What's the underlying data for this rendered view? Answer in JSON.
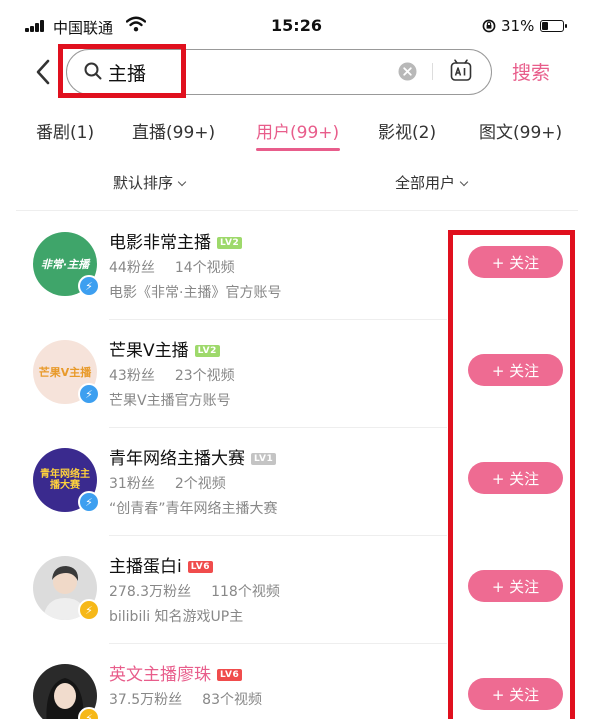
{
  "status_bar": {
    "carrier": "中国联通",
    "time": "15:26",
    "battery": "31%",
    "battery_level": 0.31
  },
  "search": {
    "query": "主播",
    "button": "搜索"
  },
  "tabs": [
    {
      "label": "番剧(1)"
    },
    {
      "label": "直播(99+)"
    },
    {
      "label": "用户(99+)",
      "active": true
    },
    {
      "label": "影视(2)"
    },
    {
      "label": "图文(99+)"
    }
  ],
  "filters": {
    "sort": "默认排序",
    "user_type": "全部用户"
  },
  "users": [
    {
      "name": "电影非常主播",
      "level": "LV2",
      "level_color": "#9ed96b",
      "fans": "44粉丝",
      "videos": "14个视频",
      "desc": "电影《非常·主播》官方账号",
      "avatar_text": "非常·主播",
      "avatar_bg": "#3fa56a",
      "badge_color": "#3d9ff0",
      "follow": "+ 关注"
    },
    {
      "name": "芒果V主播",
      "level": "LV2",
      "level_color": "#9ed96b",
      "fans": "43粉丝",
      "videos": "23个视频",
      "desc": "芒果V主播官方账号",
      "avatar_text": "芒果V主播",
      "avatar_bg": "#f6e3da",
      "badge_color": "#3d9ff0",
      "follow": "+ 关注"
    },
    {
      "name": "青年网络主播大赛",
      "level": "LV1",
      "level_color": "#c4c4c4",
      "fans": "31粉丝",
      "videos": "2个视频",
      "desc": "“创青春”青年网络主播大赛",
      "avatar_text": "青年网络主播大赛",
      "avatar_bg": "#3a2a8e",
      "badge_color": "#3d9ff0",
      "follow": "+ 关注"
    },
    {
      "name": "主播蛋白i",
      "level": "LV6",
      "level_color": "#f04c4c",
      "fans": "278.3万粉丝",
      "videos": "118个视频",
      "desc": "bilibili 知名游戏UP主",
      "avatar_text": "",
      "avatar_bg": "#d8d8d8",
      "badge_color": "#f6b818",
      "follow": "+ 关注"
    },
    {
      "name": "英文主播廖珠",
      "level": "LV6",
      "level_color": "#f04c4c",
      "fans": "37.5万粉丝",
      "videos": "83个视频",
      "desc": "",
      "avatar_text": "",
      "avatar_bg": "#2a2a2a",
      "badge_color": "#f6b818",
      "follow": "+ 关注",
      "highlight": true
    }
  ],
  "colors": {
    "accent": "#e85d8b",
    "follow_button": "#ee6b92",
    "annotation_red": "#e0101e"
  }
}
